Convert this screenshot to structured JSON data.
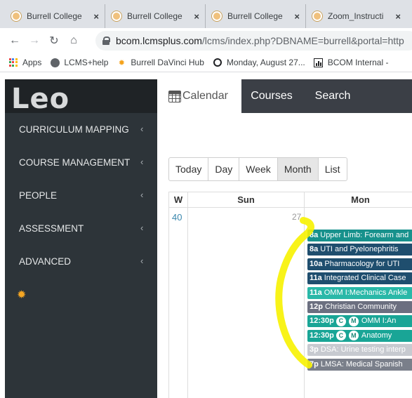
{
  "browser": {
    "tabs": [
      {
        "title": "Burrell College"
      },
      {
        "title": "Burrell College"
      },
      {
        "title": "Burrell College"
      },
      {
        "title": "Zoom_Instructi"
      }
    ],
    "url_host": "bcom.lcmsplus.com",
    "url_rest": "/lcms/index.php?DBNAME=burrell&portal=http",
    "bookmarks": [
      "Apps",
      "LCMS+help",
      "Burrell DaVinci Hub",
      "Monday, August 27...",
      "BCOM Internal -"
    ]
  },
  "app": {
    "logo": "Leo",
    "sidebar": [
      {
        "label": "CURRICULUM MAPPING"
      },
      {
        "label": "COURSE MANAGEMENT"
      },
      {
        "label": "PEOPLE"
      },
      {
        "label": "ASSESSMENT"
      },
      {
        "label": "ADVANCED"
      }
    ],
    "topnav": {
      "calendar": "Calendar",
      "courses": "Courses",
      "search": "Search"
    },
    "views": [
      "Today",
      "Day",
      "Week",
      "Month",
      "List"
    ],
    "active_view": "Month",
    "grid": {
      "week_header": "W",
      "sun_header": "Sun",
      "mon_header": "Mon",
      "week_number": "40",
      "day_number": "27"
    },
    "events": [
      {
        "time": "8a",
        "title": "Upper Limb: Forearm and",
        "color": "#17918c",
        "badges": []
      },
      {
        "time": "8a",
        "title": "UTI and Pyelonephritis",
        "color": "#1f4e6e",
        "badges": []
      },
      {
        "time": "10a",
        "title": "Pharmacology for UTI",
        "color": "#1f4e6e",
        "badges": []
      },
      {
        "time": "11a",
        "title": "Integrated Clinical Case",
        "color": "#1f4e6e",
        "badges": []
      },
      {
        "time": "11a",
        "title": "OMM I:Mechanics Ankle",
        "color": "#29b8a8",
        "badges": []
      },
      {
        "time": "12p",
        "title": "Christian Community",
        "color": "#6b6f80",
        "badges": []
      },
      {
        "time": "12:30p",
        "title": "OMM I:An",
        "color": "#19a596",
        "badges": [
          "C",
          "M"
        ]
      },
      {
        "time": "12:30p",
        "title": "Anatomy",
        "color": "#19a596",
        "badges": [
          "C",
          "M"
        ]
      },
      {
        "time": "3p",
        "title": "DSA: Urine testing interp",
        "color": "#9aa0aa",
        "badges": []
      },
      {
        "time": "7p",
        "title": "LMSA: Medical Spanish",
        "color": "#7a7f8a",
        "badges": []
      }
    ]
  }
}
